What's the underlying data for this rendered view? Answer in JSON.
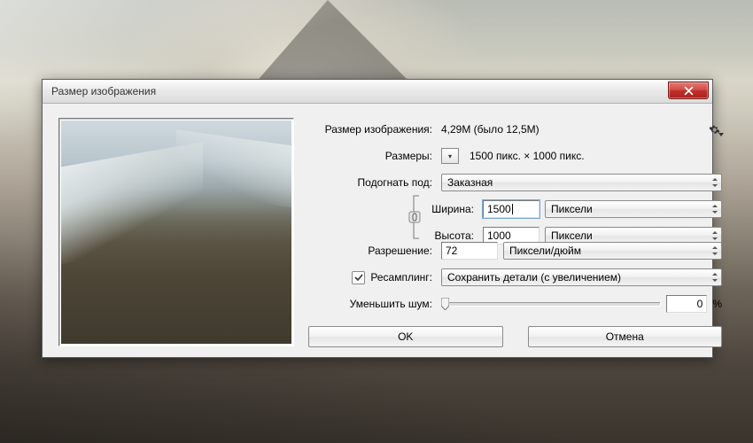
{
  "dialog": {
    "title": "Размер изображения",
    "sizeLabel": "Размер изображения:",
    "sizeValue": "4,29M (было 12,5M)",
    "dimsLabel": "Размеры:",
    "dimsValue": "1500 пикс.  ×  1000 пикс.",
    "fitLabel": "Подогнать под:",
    "fitValue": "Заказная",
    "widthLabel": "Ширина:",
    "widthValue": "1500",
    "widthUnit": "Пиксели",
    "heightLabel": "Высота:",
    "heightValue": "1000",
    "heightUnit": "Пиксели",
    "resLabel": "Разрешение:",
    "resValue": "72",
    "resUnit": "Пиксели/дюйм",
    "resampleLabel": "Ресамплинг:",
    "resampleValue": "Сохранить детали (с увеличением)",
    "noiseLabel": "Уменьшить шум:",
    "noiseValue": "0",
    "noisePct": "%",
    "ok": "OK",
    "cancel": "Отмена"
  }
}
